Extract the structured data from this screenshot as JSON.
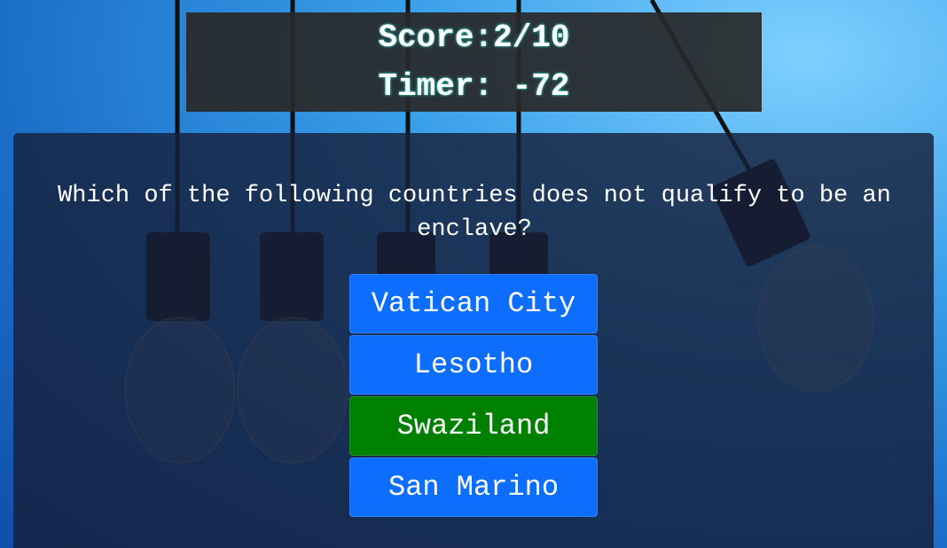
{
  "header": {
    "score": "Score:2/10",
    "timer": "Timer: -72"
  },
  "quiz": {
    "question": "Which of the following countries does not qualify to be an enclave?",
    "answers": [
      {
        "label": "Vatican City",
        "state": "default"
      },
      {
        "label": "Lesotho",
        "state": "default"
      },
      {
        "label": "Swaziland",
        "state": "correct"
      },
      {
        "label": "San Marino",
        "state": "default"
      }
    ]
  },
  "colors": {
    "answer_default": "#0d6efd",
    "answer_correct": "#008000",
    "header_bg": "#282828",
    "panel_bg": "#16203a"
  }
}
